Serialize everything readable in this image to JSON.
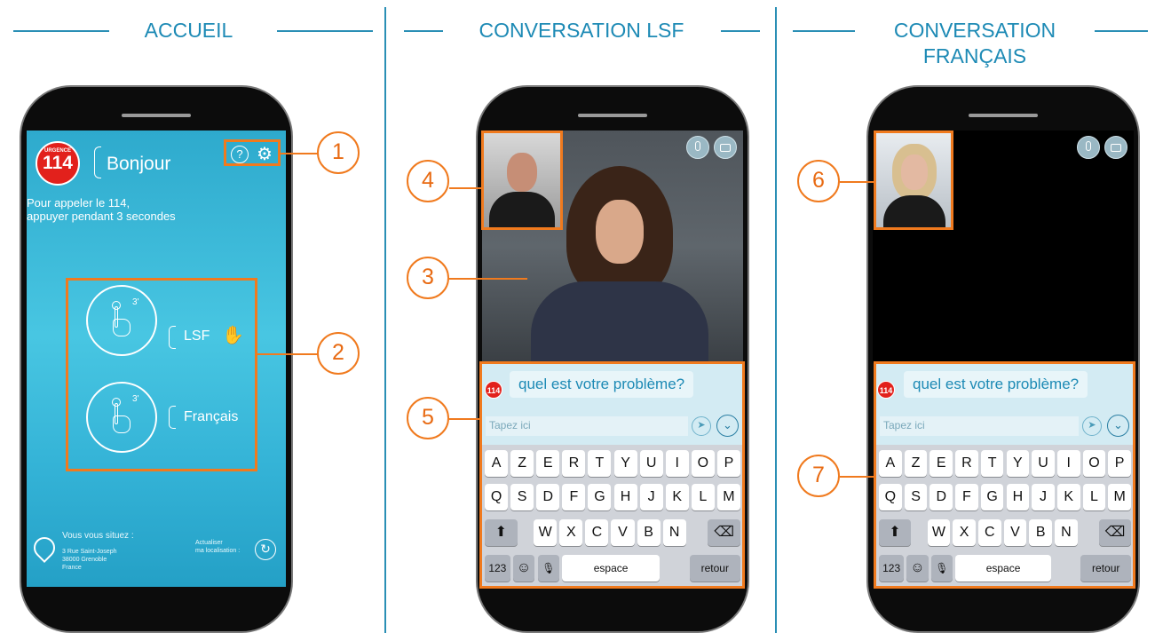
{
  "titles": {
    "home": "ACCUEIL",
    "lsf": "CONVERSATION LSF",
    "fr_line1": "CONVERSATION",
    "fr_line2": "FRANÇAIS"
  },
  "home": {
    "logo_top": "URGENCE",
    "logo_num": "114",
    "greeting": "Bonjour",
    "hint_line1": "Pour appeler le 114,",
    "hint_line2": "appuyer pendant 3 secondes",
    "timer": "3'",
    "lsf_label": "LSF",
    "fr_label": "Français",
    "location_title": "Vous vous situez :",
    "address1": "3 Rue Saint-Joseph",
    "address2": "38000 Grenoble",
    "address3": "France",
    "refresh_line1": "Actualiser",
    "refresh_line2": "ma localisation :"
  },
  "chat": {
    "logo_num": "114",
    "message": "quel est votre problème?",
    "placeholder": "Tapez ici"
  },
  "keyboard": {
    "row1": [
      "A",
      "Z",
      "E",
      "R",
      "T",
      "Y",
      "U",
      "I",
      "O",
      "P"
    ],
    "row2": [
      "Q",
      "S",
      "D",
      "F",
      "G",
      "H",
      "J",
      "K",
      "L",
      "M"
    ],
    "row3": [
      "W",
      "X",
      "C",
      "V",
      "B",
      "N"
    ],
    "k123": "123",
    "space": "espace",
    "ret": "retour",
    "emoji": "☺",
    "mic": "🎙",
    "shift": "⬆",
    "backspace": "⌫"
  },
  "callouts": [
    "1",
    "2",
    "3",
    "4",
    "5",
    "6",
    "7"
  ],
  "colors": {
    "accent_blue": "#1d8ab5",
    "callout_orange": "#f07a1e",
    "logo_red": "#e2211c"
  }
}
